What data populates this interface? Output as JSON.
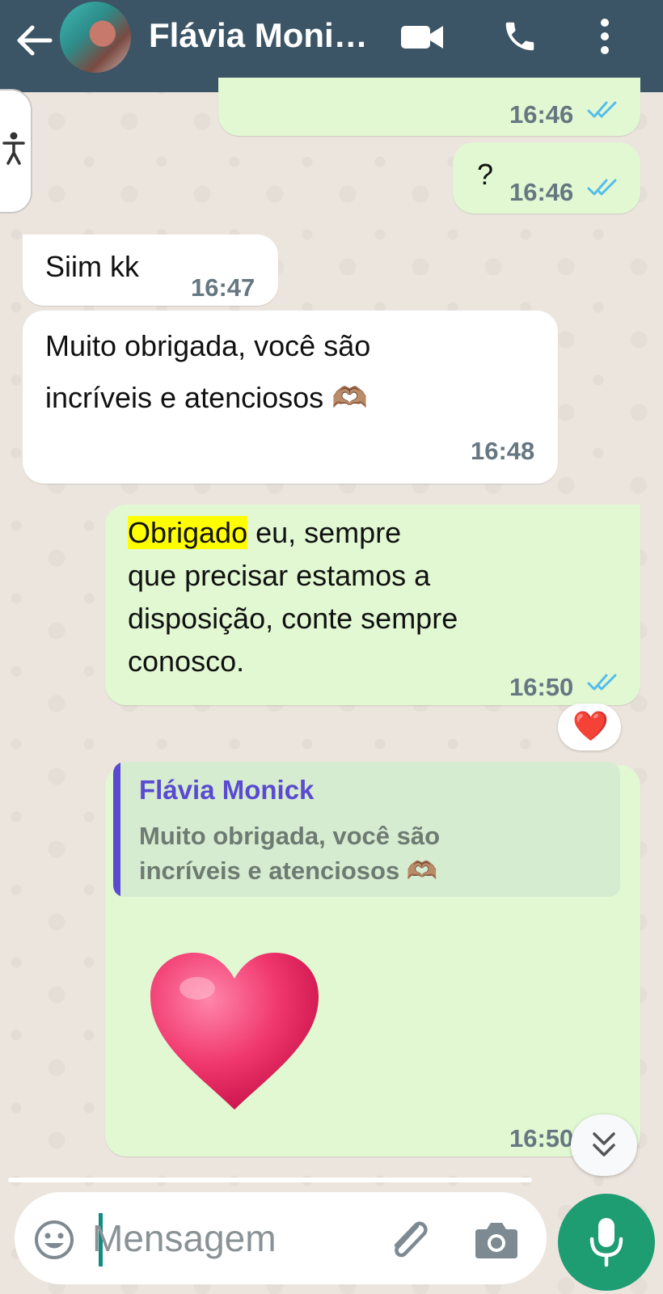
{
  "header": {
    "contact_name": "Flávia Moni…",
    "icons": [
      "back-arrow-icon",
      "video-call-icon",
      "voice-call-icon",
      "more-options-icon"
    ]
  },
  "messages": [
    {
      "direction": "out",
      "text": "",
      "time": "16:46",
      "status": "read"
    },
    {
      "direction": "out",
      "text": "?",
      "time": "16:46",
      "status": "read"
    },
    {
      "direction": "in",
      "text": "Siim kk",
      "time": "16:47"
    },
    {
      "direction": "in",
      "text": "Muito obrigada, você são\nincríveis e atenciosos 🫶🏽",
      "time": "16:48"
    },
    {
      "direction": "out",
      "text_highlight": "Obrigado",
      "text_rest": " eu, sempre\nque precisar estamos a\ndisposição,  conte sempre\nconosco.",
      "time": "16:50",
      "status": "read",
      "reaction": "❤️"
    },
    {
      "direction": "out",
      "reply_to": {
        "author": "Flávia Monick",
        "text": "Muito obrigada, você são\nincríveis e atenciosos 🫶🏽"
      },
      "sticker": "pink-heart",
      "time": "16:50",
      "status": "read"
    }
  ],
  "input": {
    "placeholder": "Mensagem"
  },
  "colors": {
    "header": "#3b5566",
    "outgoing_bubble": "#e1f8d3",
    "incoming_bubble": "#ffffff",
    "read_ticks": "#53bdeb",
    "highlight": "#ffff00",
    "quote_author": "#5a4ad1",
    "mic_button": "#1e9d72"
  }
}
